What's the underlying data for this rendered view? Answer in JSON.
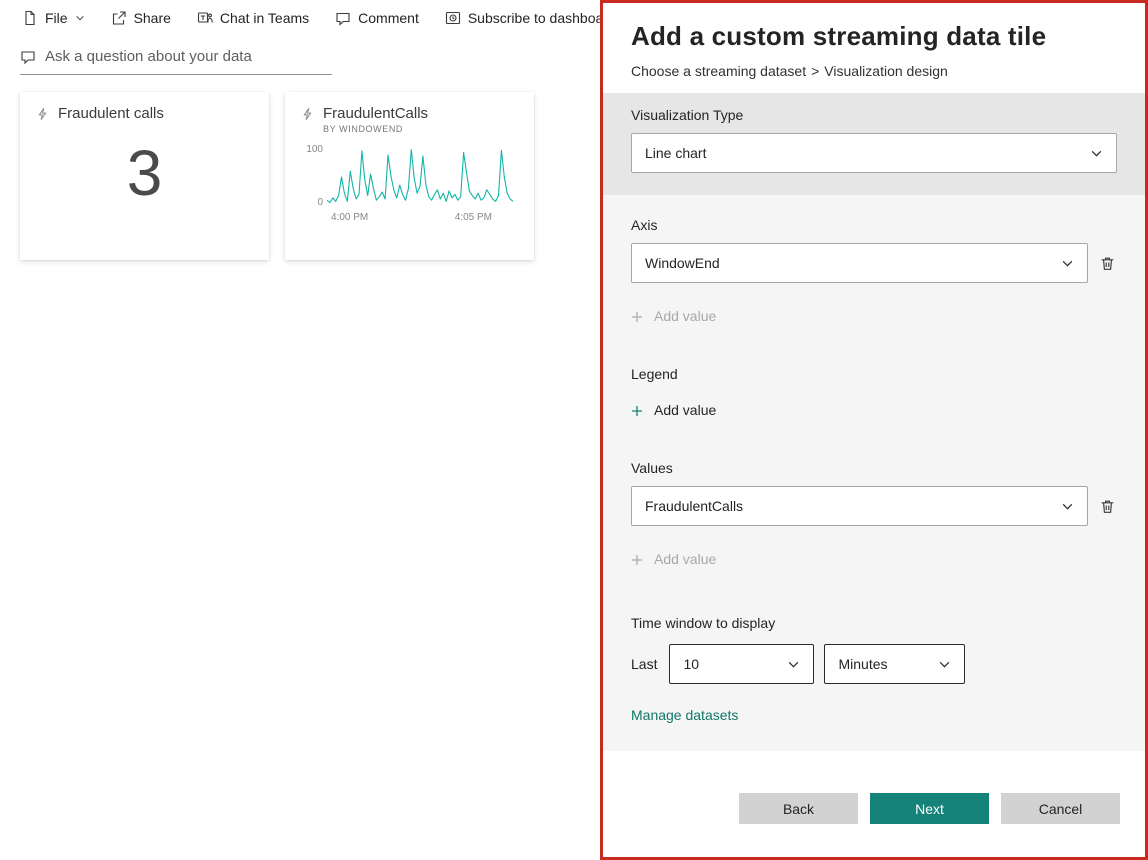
{
  "toolbar": {
    "items": [
      {
        "label": "File",
        "icon": "file-icon",
        "has_chevron": true
      },
      {
        "label": "Share",
        "icon": "share-icon"
      },
      {
        "label": "Chat in Teams",
        "icon": "teams-icon"
      },
      {
        "label": "Comment",
        "icon": "comment-icon"
      },
      {
        "label": "Subscribe to dashboard",
        "icon": "subscribe-icon"
      }
    ],
    "edit_icon": "pencil-icon"
  },
  "qa": {
    "placeholder": "Ask a question about your data"
  },
  "tiles": [
    {
      "title": "Fraudulent calls",
      "value": "3"
    },
    {
      "title": "FraudulentCalls",
      "subtitle": "BY WINDOWEND"
    }
  ],
  "chart_data": {
    "type": "line",
    "title": "FraudulentCalls",
    "subtitle": "BY WINDOWEND",
    "xlabel": "",
    "ylabel": "",
    "ylim": [
      0,
      100
    ],
    "y_tick_labels": [
      "100",
      "0"
    ],
    "x_tick_labels": [
      "4:00 PM",
      "4:05 PM"
    ],
    "line_color": "#12b5a8",
    "grid": false,
    "legend_position": "none",
    "series": [
      {
        "name": "FraudulentCalls",
        "values": [
          10,
          6,
          14,
          8,
          18,
          50,
          22,
          8,
          60,
          30,
          12,
          20,
          95,
          45,
          18,
          55,
          30,
          10,
          16,
          24,
          12,
          88,
          52,
          28,
          14,
          36,
          20,
          10,
          30,
          97,
          48,
          22,
          34,
          86,
          38,
          16,
          10,
          20,
          28,
          12,
          22,
          8,
          26,
          14,
          20,
          10,
          16,
          92,
          58,
          26,
          18,
          12,
          22,
          10,
          14,
          28,
          20,
          12,
          8,
          18,
          96,
          50,
          22,
          12,
          8
        ]
      }
    ]
  },
  "panel": {
    "title": "Add a custom streaming data tile",
    "breadcrumb": {
      "step1": "Choose a streaming dataset",
      "separator": ">",
      "step2": "Visualization design"
    },
    "visualization_type": {
      "label": "Visualization Type",
      "value": "Line chart"
    },
    "axis": {
      "label": "Axis",
      "value": "WindowEnd",
      "add_value_label": "Add value"
    },
    "legend": {
      "label": "Legend",
      "add_value_label": "Add value"
    },
    "values": {
      "label": "Values",
      "value": "FraudulentCalls",
      "add_value_label": "Add value"
    },
    "time_window": {
      "label": "Time window to display",
      "last_label": "Last",
      "amount": "10",
      "unit": "Minutes"
    },
    "manage_datasets_label": "Manage datasets",
    "buttons": {
      "back": "Back",
      "next": "Next",
      "cancel": "Cancel"
    }
  },
  "colors": {
    "accent_teal": "#12b5a8",
    "button_teal": "#16837a",
    "link_teal": "#117865",
    "annotation_border_red": "#c92a20",
    "viz_band_gray": "#e6e6e6",
    "panel_body_gray": "#f5f5f5"
  }
}
